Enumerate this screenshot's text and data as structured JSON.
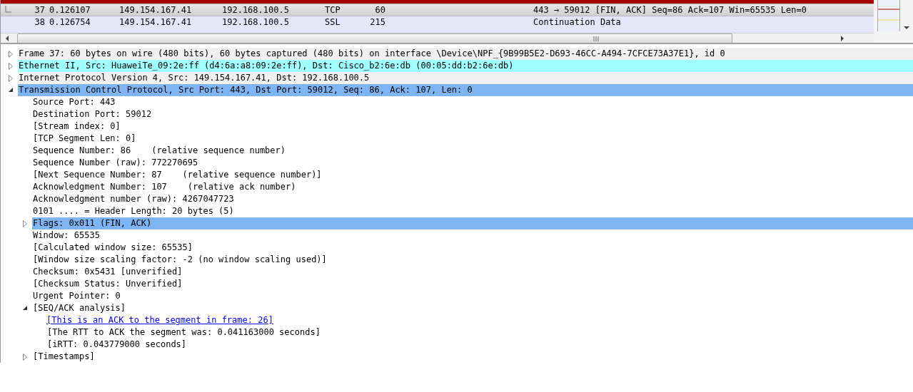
{
  "packet_list": {
    "rows": [
      {
        "no": "37",
        "time": "0.126107",
        "source": "149.154.167.41",
        "destination": "192.168.100.5",
        "protocol": "TCP",
        "length": "60",
        "info": "443 → 59012 [FIN, ACK] Seq=86 Ack=107 Win=65535 Len=0",
        "selected": true
      },
      {
        "no": "38",
        "time": "0.126754",
        "source": "149.154.167.41",
        "destination": "192.168.100.5",
        "protocol": "SSL",
        "length": "215",
        "info": "Continuation Data",
        "selected": false
      }
    ]
  },
  "details": [
    {
      "text": "Frame 37: 60 bytes on wire (480 bits), 60 bytes captured (480 bits) on interface \\Device\\NPF_{9B99B5E2-D693-46CC-A494-7CFCE73A37E1}, id 0",
      "expanded": false,
      "selected": false,
      "color": "#f0f0f0"
    },
    {
      "text": "Ethernet II, Src: HuaweiTe_09:2e:ff (d4:6a:a8:09:2e:ff), Dst: Cisco_b2:6e:db (00:05:dd:b2:6e:db)",
      "expanded": false,
      "selected": false,
      "color": "#a0ffff"
    },
    {
      "text": "Internet Protocol Version 4, Src: 149.154.167.41, Dst: 192.168.100.5",
      "expanded": false,
      "selected": false,
      "color": "#f0f0f0"
    },
    {
      "text": "Transmission Control Protocol, Src Port: 443, Dst Port: 59012, Seq: 86, Ack: 107, Len: 0",
      "expanded": true,
      "selected": true,
      "children": [
        {
          "text": "Source Port: 443"
        },
        {
          "text": "Destination Port: 59012"
        },
        {
          "text": "[Stream index: 0]"
        },
        {
          "text": "[TCP Segment Len: 0]"
        },
        {
          "text": "Sequence Number: 86    (relative sequence number)"
        },
        {
          "text": "Sequence Number (raw): 772270695"
        },
        {
          "text": "[Next Sequence Number: 87    (relative sequence number)]"
        },
        {
          "text": "Acknowledgment Number: 107    (relative ack number)"
        },
        {
          "text": "Acknowledgment number (raw): 4267047723"
        },
        {
          "text": "0101 .... = Header Length: 20 bytes (5)"
        },
        {
          "text": "Flags: 0x011 (FIN, ACK)",
          "expanded": false,
          "selected": true
        },
        {
          "text": "Window: 65535"
        },
        {
          "text": "[Calculated window size: 65535]"
        },
        {
          "text": "[Window size scaling factor: -2 (no window scaling used)]"
        },
        {
          "text": "Checksum: 0x5431 [unverified]"
        },
        {
          "text": "[Checksum Status: Unverified]"
        },
        {
          "text": "Urgent Pointer: 0"
        },
        {
          "text": "[SEQ/ACK analysis]",
          "expanded": true,
          "selected": false,
          "children": [
            {
              "text": "[This is an ACK to the segment in frame: 26]",
              "kind": "link"
            },
            {
              "text": "[The RTT to ACK the segment was: 0.041163000 seconds]"
            },
            {
              "text": "[iRTT: 0.043779000 seconds]"
            }
          ]
        },
        {
          "text": "[Timestamps]",
          "expanded": false,
          "selected": false
        }
      ]
    }
  ]
}
